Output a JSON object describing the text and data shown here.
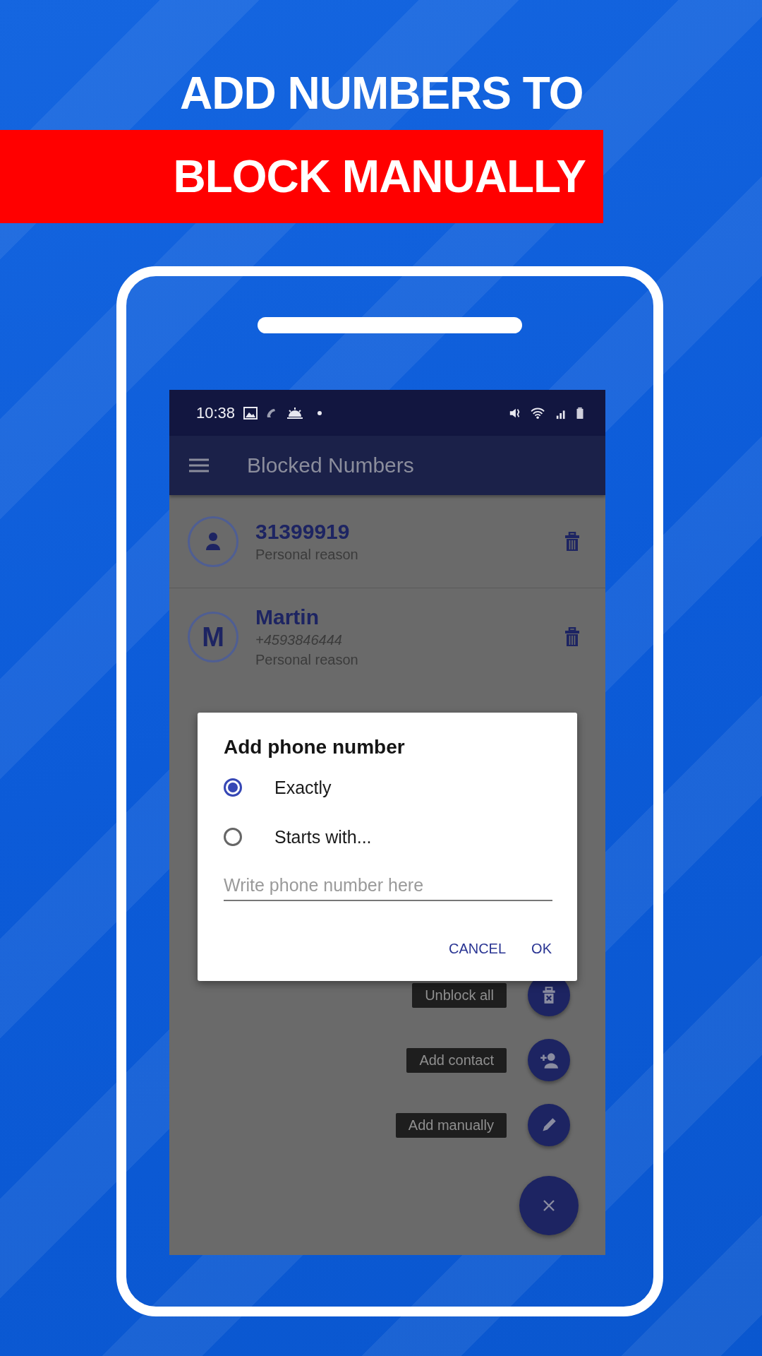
{
  "promo": {
    "headline": "ADD NUMBERS TO",
    "banner": "BLOCK MANUALLY"
  },
  "status_bar": {
    "time": "10:38"
  },
  "app_bar": {
    "title": "Blocked Numbers"
  },
  "blocked": [
    {
      "kind": "person",
      "title": "31399919",
      "reason": "Personal reason"
    },
    {
      "kind": "letter",
      "initial": "M",
      "title": "Martin",
      "number": "+4593846444",
      "reason": "Personal reason"
    }
  ],
  "fab_actions": [
    {
      "label": "Unblock all",
      "kind": "unblock"
    },
    {
      "label": "Add contact",
      "kind": "contact"
    },
    {
      "label": "Add manually",
      "kind": "manual"
    }
  ],
  "dialog": {
    "title": "Add phone number",
    "options": [
      {
        "label": "Exactly",
        "selected": true
      },
      {
        "label": "Starts with...",
        "selected": false
      }
    ],
    "input": {
      "placeholder": "Write phone number here"
    },
    "buttons": [
      "CANCEL",
      "OK"
    ]
  }
}
